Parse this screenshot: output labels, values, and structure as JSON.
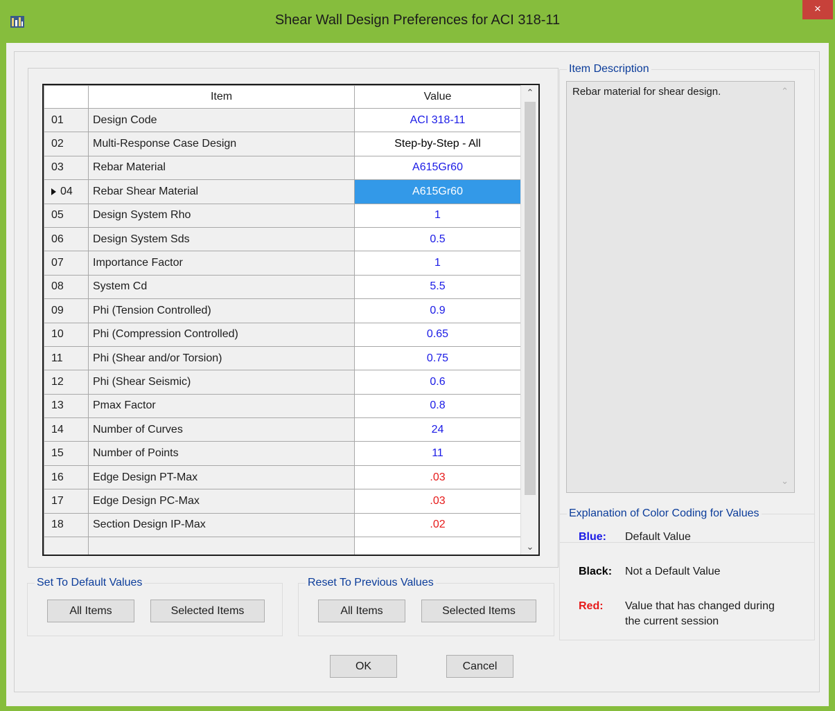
{
  "window": {
    "title": "Shear Wall Design Preferences for ACI 318-11",
    "close_label": "×"
  },
  "grid": {
    "headers": {
      "item": "Item",
      "value": "Value"
    },
    "rows": [
      {
        "num": "01",
        "item": "Design Code",
        "value": "ACI 318-11",
        "color": "blue"
      },
      {
        "num": "02",
        "item": "Multi-Response Case Design",
        "value": "Step-by-Step - All",
        "color": "black"
      },
      {
        "num": "03",
        "item": "Rebar Material",
        "value": "A615Gr60",
        "color": "blue"
      },
      {
        "num": "04",
        "item": "Rebar Shear Material",
        "value": "A615Gr60",
        "color": "selected"
      },
      {
        "num": "05",
        "item": "Design System Rho",
        "value": "1",
        "color": "blue"
      },
      {
        "num": "06",
        "item": "Design System Sds",
        "value": "0.5",
        "color": "blue"
      },
      {
        "num": "07",
        "item": "Importance Factor",
        "value": "1",
        "color": "blue"
      },
      {
        "num": "08",
        "item": "System Cd",
        "value": "5.5",
        "color": "blue"
      },
      {
        "num": "09",
        "item": "Phi (Tension Controlled)",
        "value": "0.9",
        "color": "blue"
      },
      {
        "num": "10",
        "item": "Phi (Compression Controlled)",
        "value": "0.65",
        "color": "blue"
      },
      {
        "num": "11",
        "item": "Phi (Shear and/or Torsion)",
        "value": "0.75",
        "color": "blue"
      },
      {
        "num": "12",
        "item": "Phi (Shear Seismic)",
        "value": "0.6",
        "color": "blue"
      },
      {
        "num": "13",
        "item": "Pmax Factor",
        "value": "0.8",
        "color": "blue"
      },
      {
        "num": "14",
        "item": "Number of Curves",
        "value": "24",
        "color": "blue"
      },
      {
        "num": "15",
        "item": "Number of Points",
        "value": "11",
        "color": "blue"
      },
      {
        "num": "16",
        "item": "Edge Design PT-Max",
        "value": ".03",
        "color": "red"
      },
      {
        "num": "17",
        "item": "Edge Design PC-Max",
        "value": ".03",
        "color": "red"
      },
      {
        "num": "18",
        "item": "Section Design IP-Max",
        "value": ".02",
        "color": "red"
      }
    ]
  },
  "description": {
    "label": "Item Description",
    "text": "Rebar material for shear design."
  },
  "set_default": {
    "label": "Set To Default Values",
    "all": "All Items",
    "selected": "Selected Items"
  },
  "reset_previous": {
    "label": "Reset To Previous Values",
    "all": "All Items",
    "selected": "Selected Items"
  },
  "legend": {
    "label": "Explanation of Color Coding for Values",
    "blue_key": "Blue:",
    "blue_desc": "Default Value",
    "black_key": "Black:",
    "black_desc": "Not a Default Value",
    "red_key": "Red:",
    "red_desc_1": "Value that has changed during",
    "red_desc_2": "the current session"
  },
  "buttons": {
    "ok": "OK",
    "cancel": "Cancel"
  },
  "colors": {
    "blue": "#1a1ae6",
    "black": "#000000",
    "red": "#e61a1a",
    "selected": "#3399e8",
    "titlebar": "#86bd3d"
  }
}
